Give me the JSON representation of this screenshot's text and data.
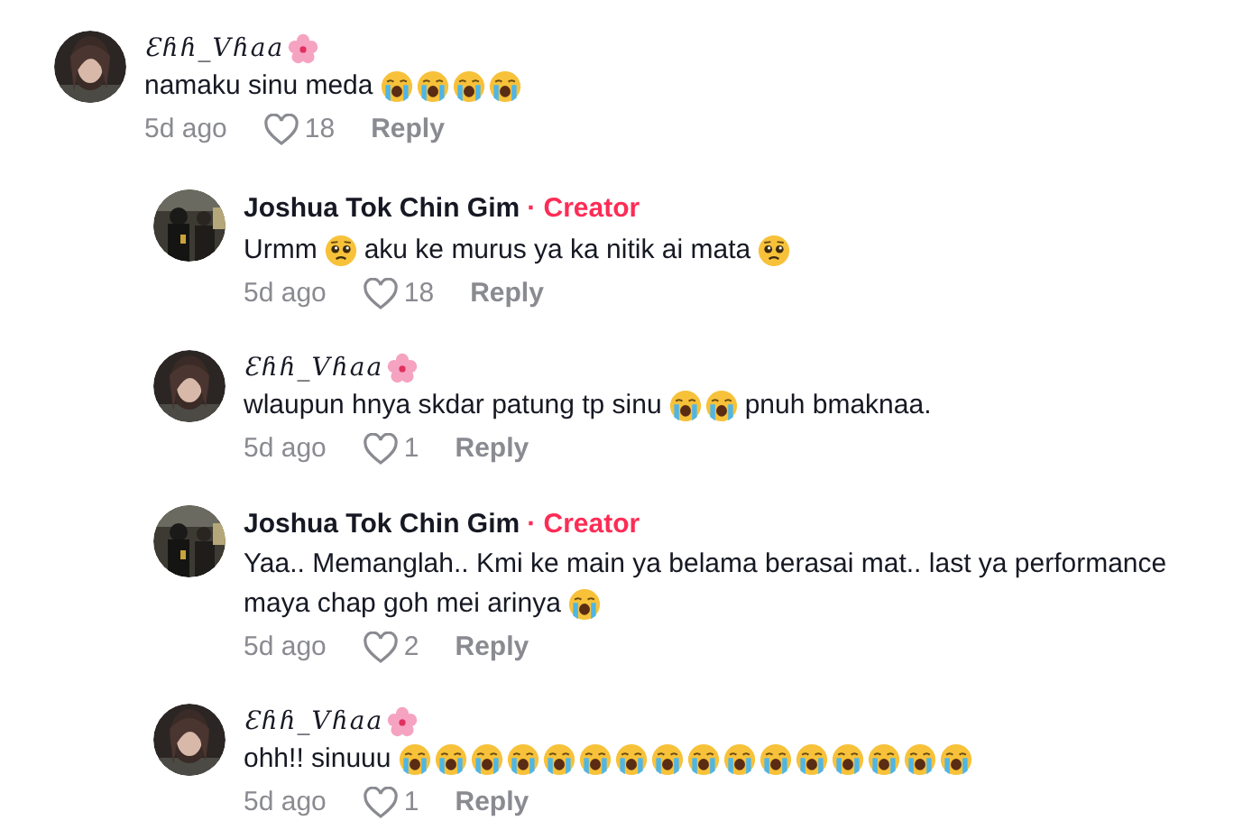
{
  "comments": [
    {
      "author": "Ɛɦɦ_Vɦaa",
      "author_flower": true,
      "reply": false,
      "avatar": {
        "kind": "picture"
      },
      "lines": [
        [
          {
            "kind": "text",
            "text": "namaku sinu meda"
          },
          {
            "kind": "crying"
          },
          {
            "kind": "crying"
          },
          {
            "kind": "crying"
          },
          {
            "kind": "crying"
          }
        ]
      ],
      "time": "5d ago",
      "likes": "18",
      "reply_label": "Reply"
    },
    {
      "author": "Joshua Tok Chin Gim",
      "author_flower": false,
      "creator_label": "· Creator",
      "reply": true,
      "avatar": {
        "kind": "picture"
      },
      "lines": [
        [
          {
            "kind": "text",
            "text": "Urmm"
          },
          {
            "kind": "pleading"
          },
          {
            "kind": "text",
            "text": "aku ke murus ya ka nitik ai mata"
          },
          {
            "kind": "pleading"
          }
        ]
      ],
      "time": "5d ago",
      "likes": "18",
      "reply_label": "Reply"
    },
    {
      "author": "Ɛɦɦ_Vɦaa",
      "author_flower": true,
      "reply": true,
      "avatar": {
        "kind": "picture"
      },
      "lines": [
        [
          {
            "kind": "text",
            "text": "wlaupun hnya skdar patung tp sinu"
          },
          {
            "kind": "crying"
          },
          {
            "kind": "crying"
          },
          {
            "kind": "text",
            "text": "pnuh bmaknaa."
          }
        ]
      ],
      "time": "5d ago",
      "likes": "1",
      "reply_label": "Reply"
    },
    {
      "author": "Joshua Tok Chin Gim",
      "author_flower": false,
      "creator_label": "· Creator",
      "reply": true,
      "avatar": {
        "kind": "picture"
      },
      "lines": [
        [
          {
            "kind": "text",
            "text": "Yaa.. Memanglah.. Kmi ke main ya belama berasai mat.. last ya performance"
          }
        ],
        [
          {
            "kind": "text",
            "text": "maya chap goh mei arinya"
          },
          {
            "kind": "crying"
          }
        ]
      ],
      "time": "5d ago",
      "likes": "2",
      "reply_label": "Reply"
    },
    {
      "author": "Ɛɦɦ_Vɦaa",
      "author_flower": true,
      "reply": true,
      "avatar": {
        "kind": "picture"
      },
      "lines": [
        [
          {
            "kind": "text",
            "text": "ohh!! sinuuu"
          },
          {
            "kind": "crying"
          },
          {
            "kind": "crying"
          },
          {
            "kind": "crying"
          },
          {
            "kind": "crying"
          },
          {
            "kind": "crying"
          },
          {
            "kind": "crying"
          },
          {
            "kind": "crying"
          },
          {
            "kind": "crying"
          },
          {
            "kind": "crying"
          },
          {
            "kind": "crying"
          },
          {
            "kind": "crying"
          },
          {
            "kind": "crying"
          },
          {
            "kind": "crying"
          },
          {
            "kind": "crying"
          },
          {
            "kind": "crying"
          },
          {
            "kind": "crying"
          }
        ]
      ],
      "time": "5d ago",
      "likes": "1",
      "reply_label": "Reply"
    }
  ]
}
